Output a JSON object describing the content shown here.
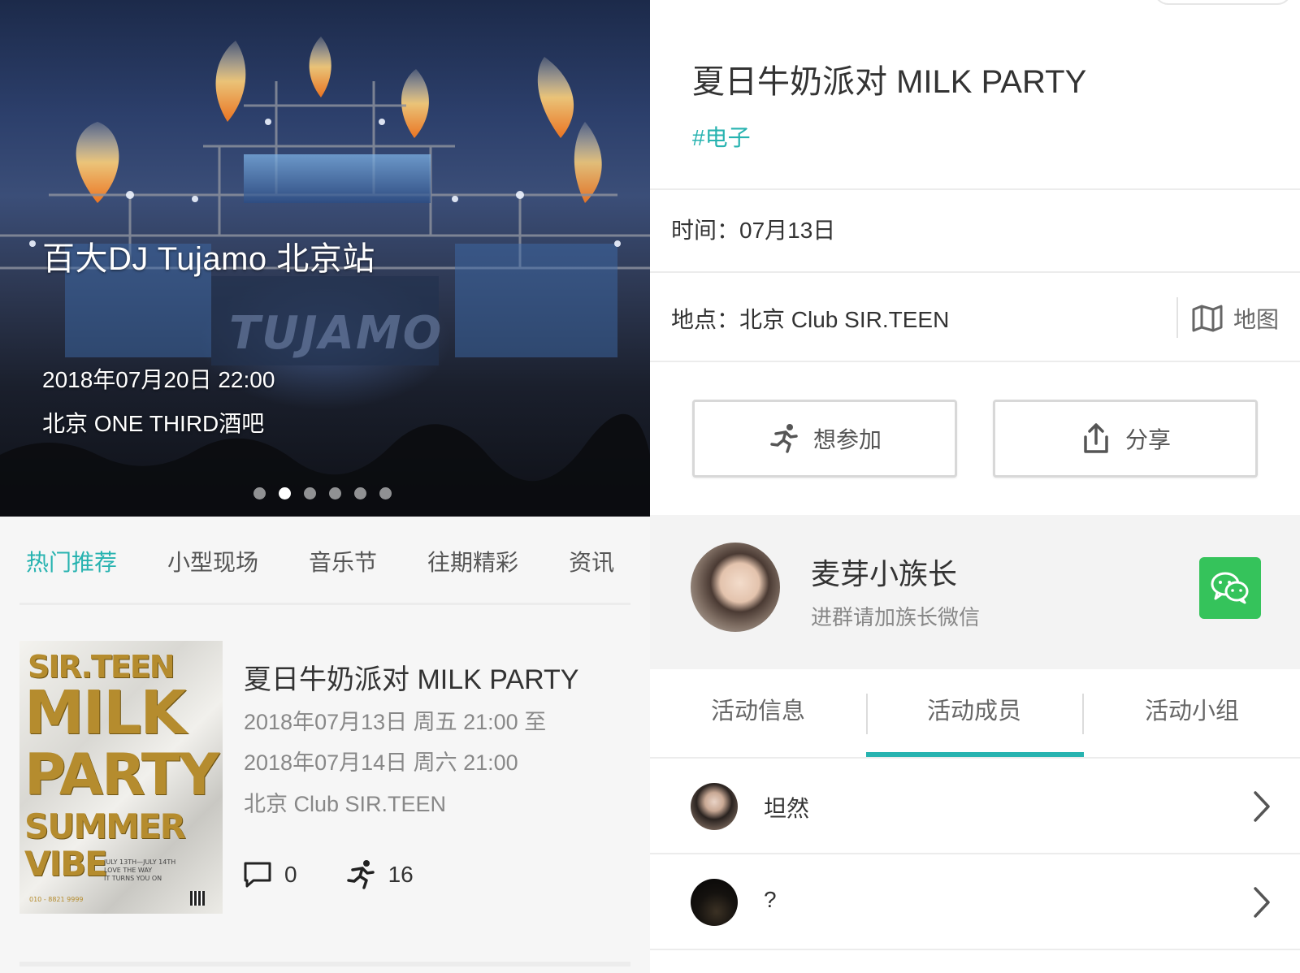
{
  "left": {
    "banner": {
      "title": "百大DJ Tujamo 北京站",
      "date": "2018年07月20日 22:00",
      "venue": "北京 ONE THIRD酒吧",
      "watermark": "TUJAMO",
      "dots_total": 6,
      "dots_active_index": 1
    },
    "categories": [
      {
        "label": "热门推荐",
        "active": true
      },
      {
        "label": "小型现场",
        "active": false
      },
      {
        "label": "音乐节",
        "active": false
      },
      {
        "label": "往期精彩",
        "active": false
      },
      {
        "label": "资讯",
        "active": false
      }
    ],
    "event": {
      "poster": {
        "line1": "SIR.TEEN",
        "line2": "MILK",
        "line3": "PARTY",
        "line4": "SUMMER",
        "line5": "VIBE",
        "small1": "JULY 13TH—JULY 14TH",
        "small2": "LOVE THE WAY",
        "small3": "IT TURNS YOU ON",
        "phone": "010 - 8821 9999"
      },
      "title": "夏日牛奶派对 MILK PARTY",
      "time_start": "2018年07月13日 周五 21:00 至",
      "time_end": "2018年07月14日 周六 21:00",
      "venue": "北京 Club SIR.TEEN",
      "comments": "0",
      "participants": "16",
      "icons": {
        "comment": "comment-icon",
        "run": "running-icon"
      }
    }
  },
  "right": {
    "title": "夏日牛奶派对 MILK PARTY",
    "tag": "#电子",
    "time_label": "时间：",
    "time_value": "07月13日",
    "place_label": "地点：",
    "place_value": "北京 Club SIR.TEEN",
    "map_label": "地图",
    "join_label": "想参加",
    "share_label": "分享",
    "leader": {
      "name": "麦芽小族长",
      "subtitle": "进群请加族长微信"
    },
    "tabs": [
      {
        "label": "活动信息",
        "active": false
      },
      {
        "label": "活动成员",
        "active": true
      },
      {
        "label": "活动小组",
        "active": false
      }
    ],
    "members": [
      {
        "name": "坦然"
      },
      {
        "name": "?"
      }
    ]
  },
  "colors": {
    "accent": "#27b3b0",
    "wechat": "#35c35b",
    "text_primary": "#333333",
    "text_secondary": "#888888"
  }
}
